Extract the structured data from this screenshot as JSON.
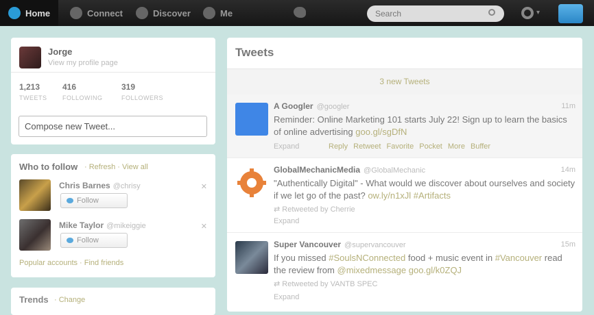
{
  "topbar": {
    "nav": [
      {
        "label": "Home",
        "icon": "home-icon"
      },
      {
        "label": "Connect",
        "icon": "connect-icon"
      },
      {
        "label": "Discover",
        "icon": "discover-icon"
      },
      {
        "label": "Me",
        "icon": "me-icon"
      }
    ],
    "search_placeholder": "Search",
    "accent": "#2a9bd6"
  },
  "profile": {
    "name": "Jorge",
    "link": "View my profile page",
    "stats": [
      {
        "value": "1,213",
        "label": "TWEETS"
      },
      {
        "value": "416",
        "label": "FOLLOWING"
      },
      {
        "value": "319",
        "label": "FOLLOWERS"
      }
    ],
    "compose_placeholder": "Compose new Tweet..."
  },
  "who_to_follow": {
    "title": "Who to follow",
    "links": "· Refresh · View all",
    "items": [
      {
        "name": "Chris Barnes",
        "handle": "@chrisy",
        "follow_label": "Follow"
      },
      {
        "name": "Mike Taylor",
        "handle": "@mikeiggie",
        "follow_label": "Follow"
      }
    ],
    "footer": "Popular accounts · Find friends"
  },
  "trends": {
    "title": "Trends",
    "change": "· Change"
  },
  "tweets": {
    "heading": "Tweets",
    "new_tweets": "3 new Tweets",
    "items": [
      {
        "name": "A Googler",
        "handle": "@googler",
        "time": "11m",
        "text": "Reminder: Online Marketing 101 starts July 22! Sign up to learn the basics of online advertising",
        "link": "goo.gl/sgDfN",
        "expand": "Expand",
        "actions": [
          "Reply",
          "Retweet",
          "Favorite",
          "Pocket",
          "More",
          "Buffer"
        ]
      },
      {
        "name": "GlobalMechanicMedia",
        "handle": "@GlobalMechanic",
        "time": "14m",
        "text": "\"Authentically Digital\" - What would we discover about ourselves and society if we let go of the past?",
        "link": "ow.ly/n1xJl #Artifacts",
        "retweeted": "Retweeted by Cherrie",
        "expand": "Expand"
      },
      {
        "name": "Super Vancouver",
        "handle": "@supervancouver",
        "time": "15m",
        "text_pre": "If you missed",
        "hashtag": "#SoulsNConnected",
        "text_mid": "food + music event in",
        "hashtag2": "#Vancouver",
        "text_post": "read the review from",
        "link": "@mixedmessage goo.gl/k0ZQJ",
        "retweeted": "Retweeted by VANTB SPEC",
        "expand": "Expand"
      }
    ]
  }
}
